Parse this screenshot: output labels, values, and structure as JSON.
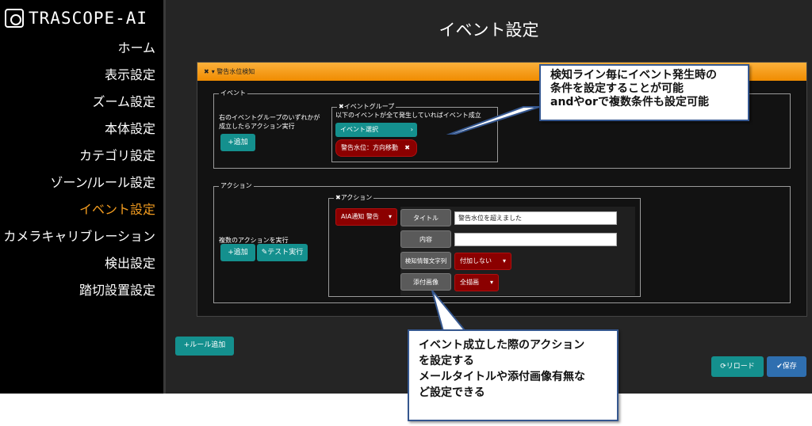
{
  "app": {
    "logo_text": "TRASCOPE-AI"
  },
  "sidebar": {
    "items": [
      {
        "label": "ホーム"
      },
      {
        "label": "表示設定"
      },
      {
        "label": "ズーム設定"
      },
      {
        "label": "本体設定"
      },
      {
        "label": "カテゴリ設定"
      },
      {
        "label": "ゾーン/ルール設定"
      },
      {
        "label": "イベント設定"
      },
      {
        "label": "カメラキャリブレーション"
      },
      {
        "label": "検出設定"
      },
      {
        "label": "踏切設置設定"
      }
    ]
  },
  "main": {
    "title": "イベント設定"
  },
  "panel": {
    "header": "警告水位検知",
    "event_section": {
      "legend": "イベント",
      "description_line1": "右のイベントグループのいずれかが",
      "description_line2": "成立したらアクション実行",
      "add_label": "+追加",
      "group": {
        "legend": "イベントグループ",
        "caption": "以下のイベントが全て発生していればイベント成立",
        "select_label": "イベント選択",
        "event_chip": "警告水位：方向移動"
      }
    },
    "action_section": {
      "legend": "アクション",
      "description": "複数のアクションを実行",
      "add_label": "+追加",
      "test_label": "テスト実行",
      "group": {
        "legend": "アクション",
        "type_label": "AIA通知 警告",
        "title_label": "タイトル",
        "title_value": "警告水位を超えました",
        "content_label": "内容",
        "content_value": "",
        "detect_label": "検知情報文字列",
        "detect_value": "付加しない",
        "image_label": "添付画像",
        "image_value": "全描画"
      }
    }
  },
  "buttons": {
    "add_rule": "+ルール追加",
    "reload": "リロード",
    "save": "保存"
  },
  "callouts": {
    "top": [
      "検知ライン毎にイベント発生時の",
      "条件を設定することが可能",
      "andやorで複数条件も設定可能"
    ],
    "bottom": [
      "イベント成立した際のアクション",
      "を設定する",
      "メールタイトルや添付画像有無な",
      "ど設定できる"
    ]
  },
  "colors": {
    "accent": "#f39c1f",
    "teal": "#14908e",
    "dark_red": "#8b0000",
    "callout_border": "#35578f"
  }
}
